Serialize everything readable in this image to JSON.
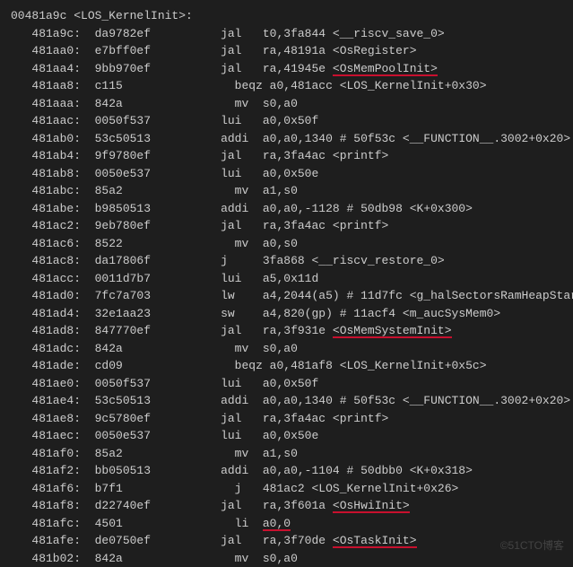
{
  "header": "00481a9c <LOS_KernelInit>:",
  "watermark": "©51CTO博客",
  "lines": [
    {
      "addr": "481a9c:",
      "hex": "da9782ef",
      "mnem": "jal",
      "args": "t0,3fa844",
      "sym": "<__riscv_save_0>"
    },
    {
      "addr": "481aa0:",
      "hex": "e7bff0ef",
      "mnem": "jal",
      "args": "ra,48191a",
      "sym": "<OsRegister>"
    },
    {
      "addr": "481aa4:",
      "hex": "9bb970ef",
      "mnem": "jal",
      "args": "ra,41945e",
      "sym": "<OsMemPoolInit>",
      "hl": true
    },
    {
      "addr": "481aa8:",
      "hex": "c115",
      "mnem": "  beqz",
      "args": "a0,481acc",
      "sym": "<LOS_KernelInit+0x30>"
    },
    {
      "addr": "481aaa:",
      "hex": "842a",
      "mnem": "  mv",
      "args": "s0,a0",
      "sym": ""
    },
    {
      "addr": "481aac:",
      "hex": "0050f537",
      "mnem": "lui",
      "args": "a0,0x50f",
      "sym": ""
    },
    {
      "addr": "481ab0:",
      "hex": "53c50513",
      "mnem": "addi",
      "args": "a0,a0,1340 # 50f53c",
      "sym": "<__FUNCTION__.3002+0x20>"
    },
    {
      "addr": "481ab4:",
      "hex": "9f9780ef",
      "mnem": "jal",
      "args": "ra,3fa4ac",
      "sym": "<printf>"
    },
    {
      "addr": "481ab8:",
      "hex": "0050e537",
      "mnem": "lui",
      "args": "a0,0x50e",
      "sym": ""
    },
    {
      "addr": "481abc:",
      "hex": "85a2",
      "mnem": "  mv",
      "args": "a1,s0",
      "sym": ""
    },
    {
      "addr": "481abe:",
      "hex": "b9850513",
      "mnem": "addi",
      "args": "a0,a0,-1128 # 50db98",
      "sym": "<K+0x300>"
    },
    {
      "addr": "481ac2:",
      "hex": "9eb780ef",
      "mnem": "jal",
      "args": "ra,3fa4ac",
      "sym": "<printf>"
    },
    {
      "addr": "481ac6:",
      "hex": "8522",
      "mnem": "  mv",
      "args": "a0,s0",
      "sym": ""
    },
    {
      "addr": "481ac8:",
      "hex": "da17806f",
      "mnem": "j",
      "args": "3fa868",
      "sym": "<__riscv_restore_0>"
    },
    {
      "addr": "481acc:",
      "hex": "0011d7b7",
      "mnem": "lui",
      "args": "a5,0x11d",
      "sym": ""
    },
    {
      "addr": "481ad0:",
      "hex": "7fc7a703",
      "mnem": "lw",
      "args": "a4,2044(a5) # 11d7fc",
      "sym": "<g_halSectorsRamHeapStart>"
    },
    {
      "addr": "481ad4:",
      "hex": "32e1aa23",
      "mnem": "sw",
      "args": "a4,820(gp) # 11acf4",
      "sym": "<m_aucSysMem0>"
    },
    {
      "addr": "481ad8:",
      "hex": "847770ef",
      "mnem": "jal",
      "args": "ra,3f931e",
      "sym": "<OsMemSystemInit>",
      "hl": true
    },
    {
      "addr": "481adc:",
      "hex": "842a",
      "mnem": "  mv",
      "args": "s0,a0",
      "sym": ""
    },
    {
      "addr": "481ade:",
      "hex": "cd09",
      "mnem": "  beqz",
      "args": "a0,481af8",
      "sym": "<LOS_KernelInit+0x5c>"
    },
    {
      "addr": "481ae0:",
      "hex": "0050f537",
      "mnem": "lui",
      "args": "a0,0x50f",
      "sym": ""
    },
    {
      "addr": "481ae4:",
      "hex": "53c50513",
      "mnem": "addi",
      "args": "a0,a0,1340 # 50f53c",
      "sym": "<__FUNCTION__.3002+0x20>"
    },
    {
      "addr": "481ae8:",
      "hex": "9c5780ef",
      "mnem": "jal",
      "args": "ra,3fa4ac",
      "sym": "<printf>"
    },
    {
      "addr": "481aec:",
      "hex": "0050e537",
      "mnem": "lui",
      "args": "a0,0x50e",
      "sym": ""
    },
    {
      "addr": "481af0:",
      "hex": "85a2",
      "mnem": "  mv",
      "args": "a1,s0",
      "sym": ""
    },
    {
      "addr": "481af2:",
      "hex": "bb050513",
      "mnem": "addi",
      "args": "a0,a0,-1104 # 50dbb0",
      "sym": "<K+0x318>"
    },
    {
      "addr": "481af6:",
      "hex": "b7f1",
      "mnem": "  j",
      "args": "481ac2",
      "sym": "<LOS_KernelInit+0x26>"
    },
    {
      "addr": "481af8:",
      "hex": "d22740ef",
      "mnem": "jal",
      "args": "ra,3f601a",
      "sym": "<OsHwiInit>",
      "hl": true
    },
    {
      "addr": "481afc:",
      "hex": "4501",
      "mnem": "  li",
      "args": "a0,0",
      "sym": "",
      "hl": true
    },
    {
      "addr": "481afe:",
      "hex": "de0750ef",
      "mnem": "jal",
      "args": "ra,3f70de",
      "sym": "<OsTaskInit>",
      "hl": true
    },
    {
      "addr": "481b02:",
      "hex": "842a",
      "mnem": "  mv",
      "args": "s0,a0",
      "sym": ""
    }
  ]
}
